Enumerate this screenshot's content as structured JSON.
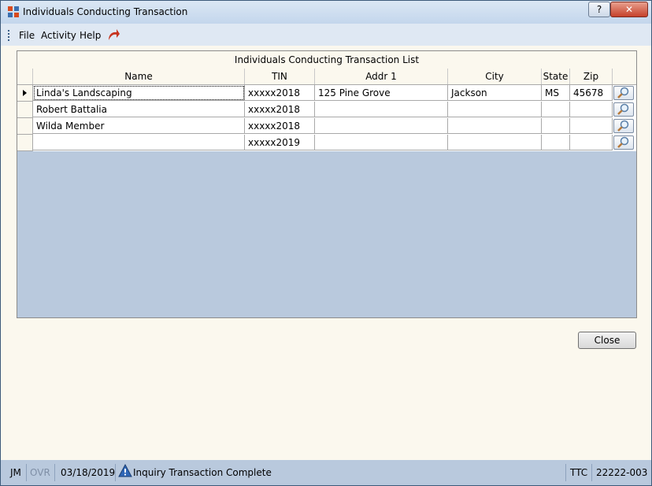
{
  "window": {
    "title": "Individuals Conducting Transaction"
  },
  "titlebar": {
    "help_label": "?",
    "close_label": "✕"
  },
  "menu": {
    "items": [
      "File",
      "Activity",
      "Help"
    ]
  },
  "grid": {
    "title": "Individuals Conducting Transaction List",
    "columns": [
      "Name",
      "TIN",
      "Addr 1",
      "City",
      "State",
      "Zip"
    ],
    "rows": [
      {
        "name": "Linda's Landscaping",
        "tin": "xxxxx2018",
        "addr1": "125 Pine Grove",
        "city": "Jackson",
        "state": "MS",
        "zip": "45678",
        "selected": true
      },
      {
        "name": "Robert Battalia",
        "tin": "xxxxx2018",
        "addr1": "",
        "city": "",
        "state": "",
        "zip": ""
      },
      {
        "name": "Wilda Member",
        "tin": "xxxxx2018",
        "addr1": "",
        "city": "",
        "state": "",
        "zip": ""
      },
      {
        "name": "",
        "tin": "xxxxx2019",
        "addr1": "",
        "city": "",
        "state": "",
        "zip": ""
      }
    ]
  },
  "actions": {
    "close_label": "Close"
  },
  "status": {
    "user": "JM",
    "ovr": "OVR",
    "date": "03/18/2019",
    "message": "Inquiry Transaction Complete",
    "code": "TTC",
    "account": "22222-003"
  },
  "icons": [
    "app-icon",
    "redo-arrow-icon",
    "magnifier-icon",
    "info-warning-icon"
  ],
  "colors": {
    "accent": "#b9c9dd",
    "background": "#fbf8ee",
    "close_red": "#c6412b"
  }
}
